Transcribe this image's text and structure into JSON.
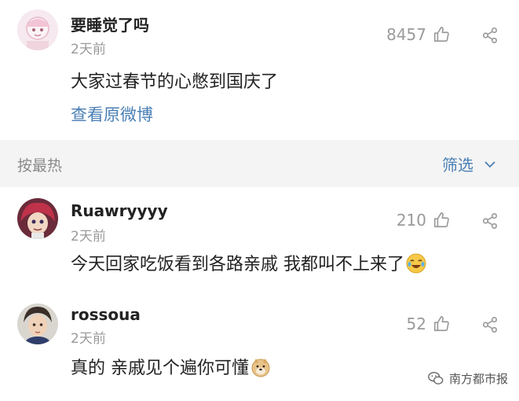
{
  "post": {
    "author": "要睡觉了吗",
    "time": "2天前",
    "likes": "8457",
    "content": "大家过春节的心憋到国庆了",
    "view_original": "查看原微博"
  },
  "sortbar": {
    "sort_label": "按最热",
    "filter_label": "筛选"
  },
  "comments": [
    {
      "author": "Ruawryyyy",
      "time": "2天前",
      "likes": "210",
      "content": "今天回家吃饭看到各路亲戚 我都叫不上来了",
      "emoji": "laugh-cry-emoji"
    },
    {
      "author": "rossoua",
      "time": "2天前",
      "likes": "52",
      "content": "真的 亲戚见个遍你可懂",
      "emoji": "doge-emoji"
    }
  ],
  "watermark": {
    "label": "南方都市报"
  },
  "colors": {
    "link": "#4a7fb5",
    "muted": "#9a9a9a",
    "sortbar_bg": "#f4f4f4"
  }
}
